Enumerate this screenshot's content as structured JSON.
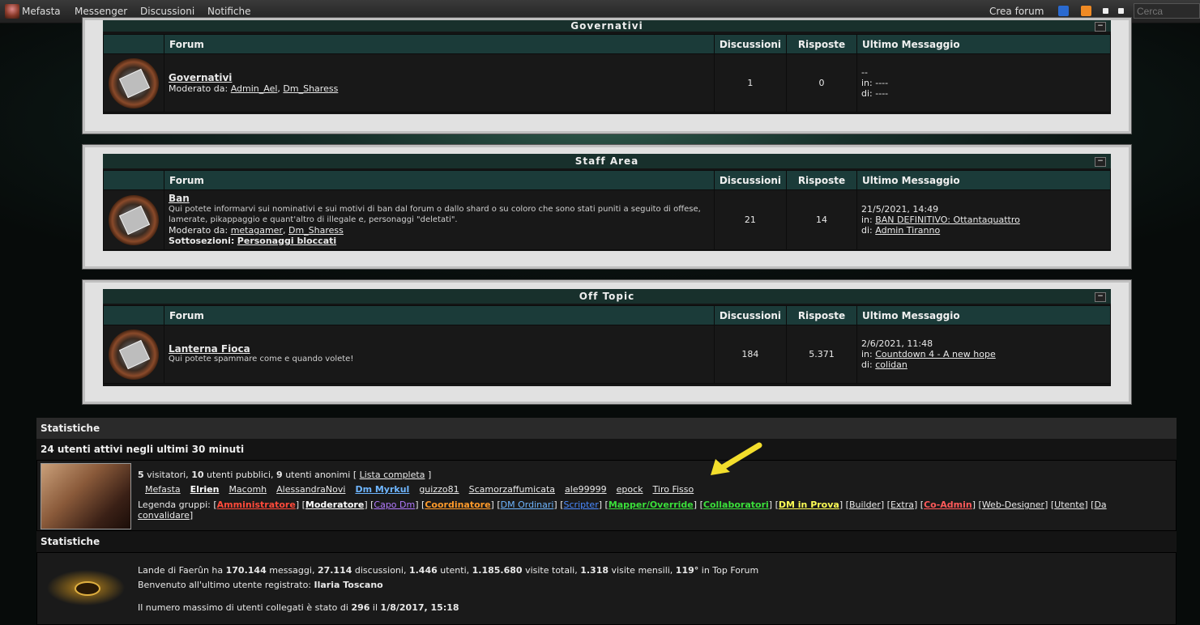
{
  "topbar": {
    "user": "Mefasta",
    "nav": [
      "Messenger",
      "Discussioni",
      "Notifiche"
    ],
    "create_forum": "Crea forum",
    "search_placeholder": "Cerca"
  },
  "categories": [
    {
      "title": "Governativi",
      "columns": [
        "Forum",
        "Discussioni",
        "Risposte",
        "Ultimo Messaggio"
      ],
      "forums": [
        {
          "name": "Governativi",
          "moderated_label": "Moderato da:",
          "moderators": [
            "Admin_Ael",
            "Dm_Sharess"
          ],
          "threads": "1",
          "replies": "0",
          "last_line1": "--",
          "last_in_label": "in:",
          "last_in": "----",
          "last_by_label": "di:",
          "last_by": "----"
        }
      ]
    },
    {
      "title": "Staff Area",
      "columns": [
        "Forum",
        "Discussioni",
        "Risposte",
        "Ultimo Messaggio"
      ],
      "forums": [
        {
          "name": "Ban",
          "description": "Qui potete informarvi sui nominativi e sui motivi di ban dal forum o dallo shard o su coloro che sono stati puniti a seguito di offese, lamerate, pikappaggio e quant'altro di illegale e, personaggi \"deletati\".",
          "moderated_label": "Moderato da:",
          "moderators": [
            "metagamer",
            "Dm_Sharess"
          ],
          "subsections_label": "Sottosezioni:",
          "subsections": "Personaggi bloccati",
          "threads": "21",
          "replies": "14",
          "last_line1": "21/5/2021, 14:49",
          "last_in_label": "in:",
          "last_in": "BAN DEFINITIVO: Ottantaquattro",
          "last_by_label": "di:",
          "last_by": "Admin Tiranno"
        }
      ]
    },
    {
      "title": "Off Topic",
      "columns": [
        "Forum",
        "Discussioni",
        "Risposte",
        "Ultimo Messaggio"
      ],
      "forums": [
        {
          "name": "Lanterna Fioca",
          "description": "Qui potete spammare come e quando volete!",
          "threads": "184",
          "replies": "5.371",
          "last_line1": "2/6/2021, 11:48",
          "last_in_label": "in:",
          "last_in": "Countdown 4 - A new hope",
          "last_by_label": "di:",
          "last_by": "colidan"
        }
      ]
    }
  ],
  "stats": {
    "header1": "Statistiche",
    "active_header": "24 utenti attivi negli ultimi 30 minuti",
    "visitors_num": "5",
    "visitors_label": "visitatori,",
    "public_num": "10",
    "public_label": "utenti pubblici,",
    "anon_num": "9",
    "anon_label": "utenti anonimi [",
    "full_list": "Lista completa",
    "full_list_close": "]",
    "users": [
      {
        "name": "Mefasta",
        "color": "#e9e9e9",
        "bold": false
      },
      {
        "name": "Elrien",
        "color": "#ffffff",
        "bold": true
      },
      {
        "name": "Macomh",
        "color": "#e9e9e9",
        "bold": false
      },
      {
        "name": "AlessandraNovi",
        "color": "#e9e9e9",
        "bold": false
      },
      {
        "name": "Dm Myrkul",
        "color": "#6fb6ff",
        "bold": true
      },
      {
        "name": "guizzo81",
        "color": "#e9e9e9",
        "bold": false
      },
      {
        "name": "Scamorzaffumicata",
        "color": "#e9e9e9",
        "bold": false
      },
      {
        "name": "ale99999",
        "color": "#e9e9e9",
        "bold": false
      },
      {
        "name": "epock",
        "color": "#e9e9e9",
        "bold": false
      },
      {
        "name": "Tiro Fisso",
        "color": "#e9e9e9",
        "bold": false
      }
    ],
    "legend_label": "Legenda gruppi:",
    "groups": [
      {
        "name": "Amministratore",
        "color": "#ff4a3a",
        "bold": true
      },
      {
        "name": "Moderatore",
        "color": "#ffffff",
        "bold": true
      },
      {
        "name": "Capo Dm",
        "color": "#b37bff",
        "bold": false
      },
      {
        "name": "Coordinatore",
        "color": "#ff9a2a",
        "bold": true
      },
      {
        "name": "DM Ordinari",
        "color": "#6fb6ff",
        "bold": false
      },
      {
        "name": "Scripter",
        "color": "#4a8aff",
        "bold": false
      },
      {
        "name": "Mapper/Override",
        "color": "#3adf3a",
        "bold": true
      },
      {
        "name": "Collaboratori",
        "color": "#3adf3a",
        "bold": true
      },
      {
        "name": "DM in Prova",
        "color": "#ffff55",
        "bold": true
      },
      {
        "name": "Builder",
        "color": "#e9e9e9",
        "bold": false
      },
      {
        "name": "Extra",
        "color": "#e9e9e9",
        "bold": false
      },
      {
        "name": "Co-Admin",
        "color": "#ff5a5a",
        "bold": true
      },
      {
        "name": "Web-Designer",
        "color": "#e9e9e9",
        "bold": false
      },
      {
        "name": "Utente",
        "color": "#e9e9e9",
        "bold": false
      },
      {
        "name": "Da convalidare",
        "color": "#e9e9e9",
        "bold": false
      }
    ],
    "header2": "Statistiche",
    "summary_prefix": "Lande di Faerûn ha",
    "messages": "170.144",
    "messages_label": "messaggi,",
    "topics": "27.114",
    "topics_label": "discussioni,",
    "users_count": "1.446",
    "users_label": "utenti,",
    "visits": "1.185.680",
    "visits_label": "visite totali,",
    "monthly": "1.318",
    "monthly_label": "visite mensili,",
    "rank": "119°",
    "rank_label": "in Top Forum",
    "welcome_label": "Benvenuto all'ultimo utente registrato:",
    "last_user": "Ilaria Toscano",
    "max_label": "Il numero massimo di utenti collegati è stato di",
    "max_users": "296",
    "max_on": "il",
    "max_date": "1/8/2017, 15:18"
  },
  "colors": {
    "annotation_arrow": "#f3de2c",
    "header_bg": "#1b3b39"
  }
}
